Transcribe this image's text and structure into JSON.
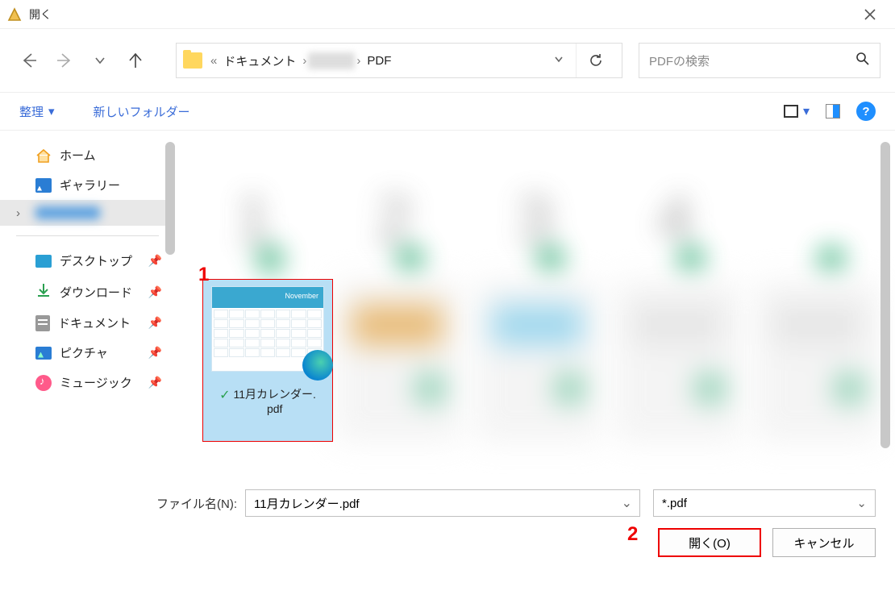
{
  "title": "開く",
  "breadcrumb": {
    "sep1": "«",
    "p1": "ドキュメント",
    "sep2": "›",
    "p2_blur": "xxxx",
    "sep3": "›",
    "p3": "PDF"
  },
  "search": {
    "placeholder": "PDFの検索"
  },
  "toolbar": {
    "organize": "整理",
    "newfolder": "新しいフォルダー"
  },
  "sidebar": {
    "home": "ホーム",
    "gallery": "ギャラリー",
    "folder_blur": "xxxxx xxxx",
    "desktop": "デスクトップ",
    "download": "ダウンロード",
    "document": "ドキュメント",
    "picture": "ピクチャ",
    "music": "ミュージック"
  },
  "selected_file": {
    "thumb_month": "November",
    "name_line1": "11月カレンダー.",
    "name_line2": "pdf"
  },
  "annotations": {
    "a1": "1",
    "a2": "2"
  },
  "bottom": {
    "label": "ファイル名(N):",
    "value": "11月カレンダー.pdf",
    "filetype": "*.pdf",
    "open": "開く(O)",
    "cancel": "キャンセル"
  }
}
